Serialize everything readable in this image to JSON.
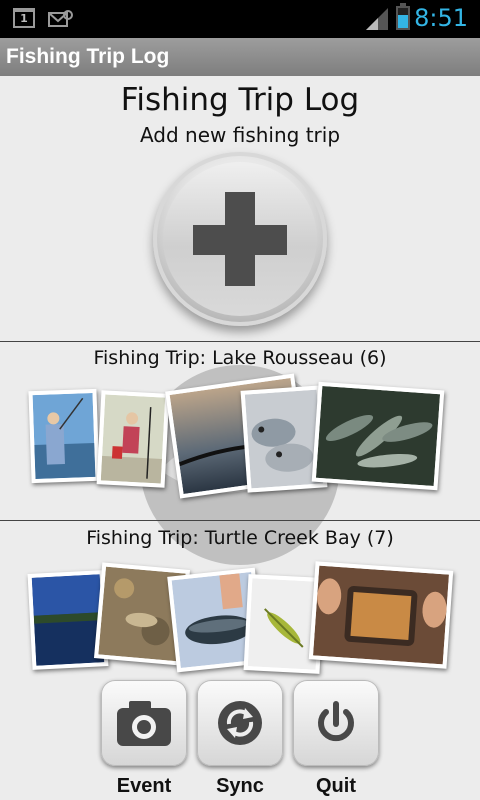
{
  "status_bar": {
    "time": "8:51",
    "calendar_day": "1",
    "icons": [
      "calendar-icon",
      "mail-icon",
      "signal-icon",
      "battery-icon"
    ]
  },
  "titlebar": {
    "title": "Fishing Trip Log"
  },
  "header": {
    "title": "Fishing Trip Log",
    "subtitle": "Add new fishing trip",
    "add_icon": "plus-icon"
  },
  "trips": [
    {
      "title": "Fishing Trip: Lake Rousseau (6)"
    },
    {
      "title": "Fishing Trip: Turtle Creek Bay (7)"
    }
  ],
  "actions": [
    {
      "label": "Event",
      "icon": "camera-icon"
    },
    {
      "label": "Sync",
      "icon": "sync-icon"
    },
    {
      "label": "Quit",
      "icon": "power-icon"
    }
  ],
  "colors": {
    "accent": "#33b5e5",
    "titlebar": "#8a8a8a",
    "background": "#ececec"
  }
}
